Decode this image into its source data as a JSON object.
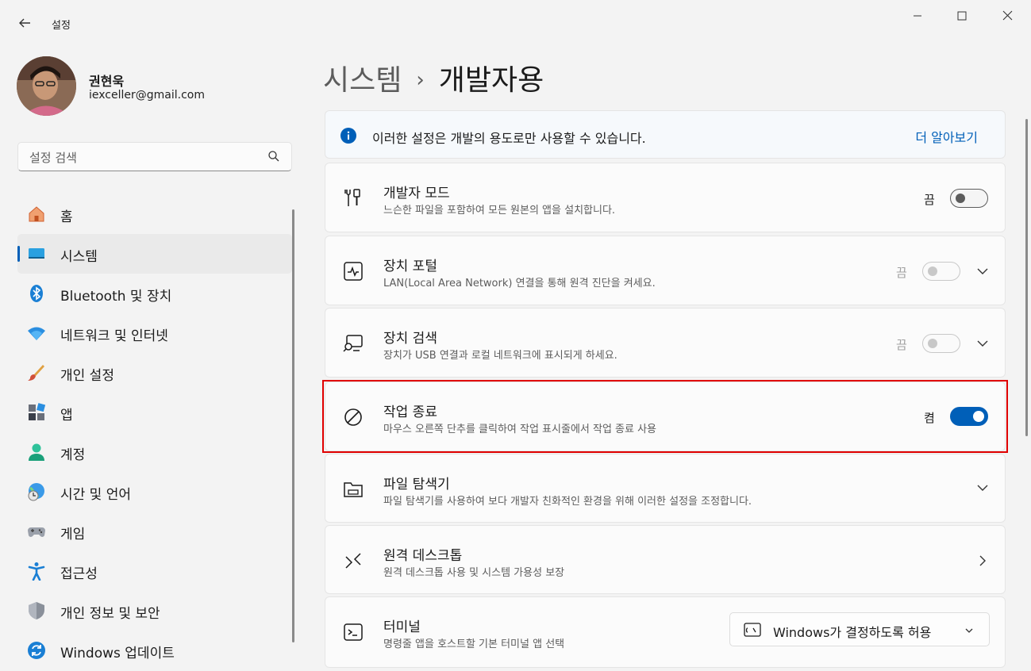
{
  "window": {
    "title": "설정"
  },
  "user": {
    "name": "권현욱",
    "email": "iexceller@gmail.com"
  },
  "search": {
    "placeholder": "설정 검색"
  },
  "nav": {
    "items": [
      {
        "label": "홈",
        "icon": "home-icon"
      },
      {
        "label": "시스템",
        "icon": "system-icon",
        "selected": true
      },
      {
        "label": "Bluetooth 및 장치",
        "icon": "bluetooth-icon"
      },
      {
        "label": "네트워크 및 인터넷",
        "icon": "wifi-icon"
      },
      {
        "label": "개인 설정",
        "icon": "brush-icon"
      },
      {
        "label": "앱",
        "icon": "apps-icon"
      },
      {
        "label": "계정",
        "icon": "account-icon"
      },
      {
        "label": "시간 및 언어",
        "icon": "globe-clock-icon"
      },
      {
        "label": "게임",
        "icon": "gamepad-icon"
      },
      {
        "label": "접근성",
        "icon": "accessibility-icon"
      },
      {
        "label": "개인 정보 및 보안",
        "icon": "shield-icon"
      },
      {
        "label": "Windows 업데이트",
        "icon": "update-icon"
      }
    ]
  },
  "breadcrumb": {
    "parent": "시스템",
    "separator": "›",
    "current": "개발자용"
  },
  "info": {
    "text": "이러한 설정은 개발의 용도로만 사용할 수 있습니다.",
    "link": "더 알아보기"
  },
  "settings": {
    "developer_mode": {
      "title": "개발자 모드",
      "desc": "느슨한 파일을 포함하여 모든 원본의 앱을 설치합니다.",
      "state": "끔"
    },
    "device_portal": {
      "title": "장치 포털",
      "desc": "LAN(Local Area Network) 연결을 통해 원격 진단을 켜세요.",
      "state": "끔"
    },
    "device_discovery": {
      "title": "장치 검색",
      "desc": "장치가 USB 연결과 로컬 네트워크에 표시되게 하세요.",
      "state": "끔"
    },
    "end_task": {
      "title": "작업 종료",
      "desc": "마우스 오른쪽 단추를 클릭하여 작업 표시줄에서 작업 종료 사용",
      "state": "켬"
    },
    "file_explorer": {
      "title": "파일 탐색기",
      "desc": "파일 탐색기를 사용하여 보다 개발자 친화적인 환경을 위해 이러한 설정을 조정합니다."
    },
    "remote_desktop": {
      "title": "원격 데스크톱",
      "desc": "원격 데스크톱 사용 및 시스템 가용성 보장"
    },
    "terminal": {
      "title": "터미널",
      "desc": "명령줄 앱을 호스트할 기본 터미널 앱 선택",
      "dropdown": "Windows가 결정하도록 허용"
    }
  },
  "colors": {
    "accent": "#005fb8",
    "highlight": "#e00000"
  }
}
